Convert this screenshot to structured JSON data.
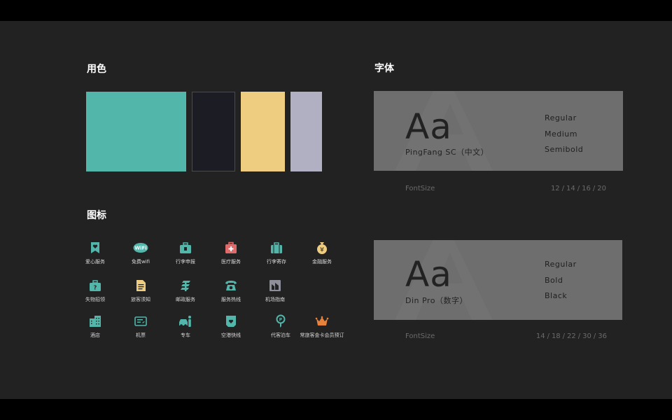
{
  "sections": {
    "color_title": "用色",
    "icon_title": "图标",
    "font_title": "字体"
  },
  "palette": [
    {
      "name": "teal",
      "hex": "#52b6ab"
    },
    {
      "name": "dark-navy",
      "hex": "#1c1c24"
    },
    {
      "name": "yellow",
      "hex": "#eecd81"
    },
    {
      "name": "lavender",
      "hex": "#b1b0c2"
    }
  ],
  "fonts": [
    {
      "sample": "Aa",
      "family": "PingFang SC（中文）",
      "weights": [
        "Regular",
        "Medium",
        "Semibold"
      ],
      "size_label": "FontSize",
      "sizes": [
        "12",
        "14",
        "16",
        "20"
      ]
    },
    {
      "sample": "Aa",
      "family": "Din Pro（数字）",
      "weights": [
        "Regular",
        "Bold",
        "Black"
      ],
      "size_label": "FontSize",
      "sizes": [
        "14",
        "18",
        "22",
        "30",
        "36"
      ]
    }
  ],
  "icons": [
    {
      "label": "爱心服务",
      "icon": "heart-bookmark-icon",
      "color": "#52b6ab"
    },
    {
      "label": "免费wifi",
      "icon": "wifi-icon",
      "color": "#52b6ab"
    },
    {
      "label": "行李申报",
      "icon": "luggage-declare-icon",
      "color": "#52b6ab"
    },
    {
      "label": "医疗服务",
      "icon": "medical-kit-icon",
      "color": "#e06a6a"
    },
    {
      "label": "行李寄存",
      "icon": "luggage-storage-icon",
      "color": "#52b6ab"
    },
    {
      "label": "金融服务",
      "icon": "money-bag-icon",
      "color": "#eecd81"
    },
    {
      "label": "失物招领",
      "icon": "lost-found-icon",
      "color": "#52b6ab"
    },
    {
      "label": "旅客须知",
      "icon": "notice-document-icon",
      "color": "#eecd81"
    },
    {
      "label": "邮政服务",
      "icon": "postal-icon",
      "color": "#52b6ab"
    },
    {
      "label": "服务热线",
      "icon": "telephone-icon",
      "color": "#52b6ab"
    },
    {
      "label": "机场指南",
      "icon": "airport-guide-icon",
      "color": "#8e8e9a"
    },
    {
      "label": "酒店",
      "icon": "hotel-building-icon",
      "color": "#52b6ab"
    },
    {
      "label": "机票",
      "icon": "air-ticket-icon",
      "color": "#52b6ab"
    },
    {
      "label": "专车",
      "icon": "private-car-icon",
      "color": "#52b6ab"
    },
    {
      "label": "空港快线",
      "icon": "airport-bus-icon",
      "color": "#52b6ab"
    },
    {
      "label": "代客泊车",
      "icon": "valet-parking-icon",
      "color": "#52b6ab"
    },
    {
      "label": "常旅客金卡会员预订",
      "icon": "crown-icon",
      "color": "#e8823a"
    }
  ]
}
